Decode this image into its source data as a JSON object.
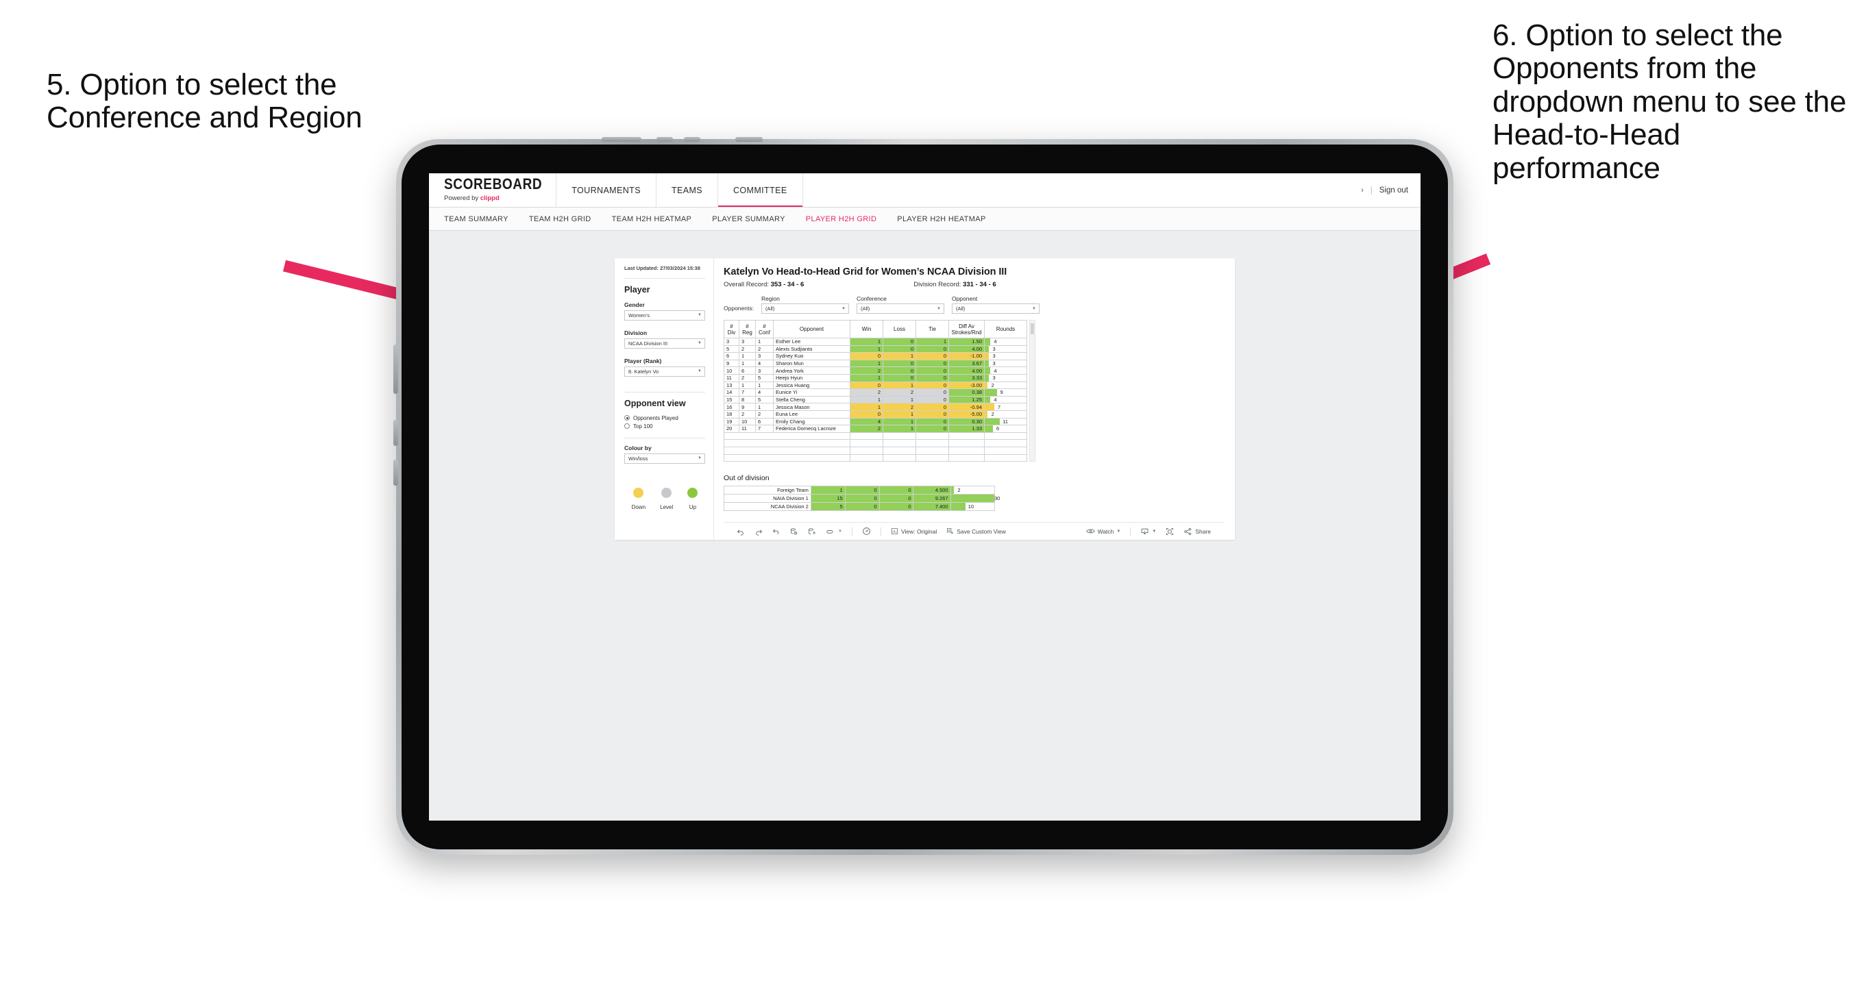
{
  "annotations": {
    "left": "5. Option to select the Conference and Region",
    "right": "6. Option to select the Opponents from the dropdown menu to see the Head-to-Head performance",
    "arrow_color": "#e8295f"
  },
  "app": {
    "brand": {
      "title": "SCOREBOARD",
      "powered_prefix": "Powered by ",
      "powered_brand": "clippd"
    },
    "topnav": [
      {
        "label": "TOURNAMENTS",
        "active": false
      },
      {
        "label": "TEAMS",
        "active": false
      },
      {
        "label": "COMMITTEE",
        "active": true
      }
    ],
    "topbar_right": {
      "chevron": "›",
      "separator": "|",
      "signout": "Sign out"
    },
    "subnav": [
      {
        "label": "TEAM SUMMARY",
        "active": false
      },
      {
        "label": "TEAM H2H GRID",
        "active": false
      },
      {
        "label": "TEAM H2H HEATMAP",
        "active": false
      },
      {
        "label": "PLAYER SUMMARY",
        "active": false
      },
      {
        "label": "PLAYER H2H GRID",
        "active": true
      },
      {
        "label": "PLAYER H2H HEATMAP",
        "active": false
      }
    ],
    "accent": "#e8295f"
  },
  "sidebar": {
    "last_updated": "Last Updated: 27/03/2024 15:38",
    "section_player": "Player",
    "fields": [
      {
        "label": "Gender",
        "value": "Women’s"
      },
      {
        "label": "Division",
        "value": "NCAA Division III"
      },
      {
        "label": "Player (Rank)",
        "value": "8. Katelyn Vo"
      }
    ],
    "opponent_view": {
      "title": "Opponent view",
      "options": [
        {
          "label": "Opponents Played",
          "selected": true
        },
        {
          "label": "Top 100",
          "selected": false
        }
      ]
    },
    "colour_by": {
      "label": "Colour by",
      "value": "Win/loss"
    },
    "legend": [
      {
        "label": "Down",
        "color": "#f5d04e"
      },
      {
        "label": "Level",
        "color": "#c6c8cb"
      },
      {
        "label": "Up",
        "color": "#8cc63e"
      }
    ]
  },
  "main": {
    "title": "Katelyn Vo Head-to-Head Grid for Women’s NCAA Division III",
    "overall_record_label": "Overall Record:",
    "overall_record_value": "353 -  34 - 6",
    "division_record_label": "Division Record:",
    "division_record_value": "331 -  34 - 6",
    "opponents_label": "Opponents:",
    "filters": [
      {
        "label": "Region",
        "value": "(All)"
      },
      {
        "label": "Conference",
        "value": "(All)"
      },
      {
        "label": "Opponent",
        "value": "(All)"
      }
    ],
    "out_of_division_title": "Out of division"
  },
  "chart_data": {
    "type": "table",
    "title": "Katelyn Vo Head-to-Head Grid for Women’s NCAA Division III",
    "columns": [
      "# Div",
      "# Reg",
      "# Conf",
      "Opponent",
      "Win",
      "Loss",
      "Tie",
      "Diff Av Strokes/Rnd",
      "Rounds"
    ],
    "column_headers_multiline": [
      [
        "#",
        "Div"
      ],
      [
        "#",
        "Reg"
      ],
      [
        "#",
        "Conf"
      ],
      [
        "Opponent"
      ],
      [
        "Win"
      ],
      [
        "Loss"
      ],
      [
        "Tie"
      ],
      [
        "Diff Av",
        "Strokes/Rnd"
      ],
      [
        "Rounds"
      ]
    ],
    "colour_scale": {
      "up": "#92d05a",
      "level": "#d5d7d9",
      "down": "#f5d04e"
    },
    "rounds_max": 30,
    "rows": [
      {
        "div": "3",
        "reg": "3",
        "conf": "1",
        "opponent": "Esther Lee",
        "win": "1",
        "loss": "0",
        "tie": "1",
        "diff": "1.50",
        "rounds": "4",
        "colour": "up"
      },
      {
        "div": "5",
        "reg": "2",
        "conf": "2",
        "opponent": "Alexis Sudjianto",
        "win": "1",
        "loss": "0",
        "tie": "0",
        "diff": "4.00",
        "rounds": "3",
        "colour": "up"
      },
      {
        "div": "6",
        "reg": "1",
        "conf": "3",
        "opponent": "Sydney Kuo",
        "win": "0",
        "loss": "1",
        "tie": "0",
        "diff": "-1.00",
        "rounds": "3",
        "colour": "down"
      },
      {
        "div": "9",
        "reg": "1",
        "conf": "4",
        "opponent": "Sharon Mun",
        "win": "1",
        "loss": "0",
        "tie": "0",
        "diff": "3.67",
        "rounds": "3",
        "colour": "up"
      },
      {
        "div": "10",
        "reg": "6",
        "conf": "3",
        "opponent": "Andrea York",
        "win": "2",
        "loss": "0",
        "tie": "0",
        "diff": "4.00",
        "rounds": "4",
        "colour": "up"
      },
      {
        "div": "11",
        "reg": "2",
        "conf": "5",
        "opponent": "Heejo Hyun",
        "win": "1",
        "loss": "0",
        "tie": "0",
        "diff": "3.33",
        "rounds": "3",
        "colour": "up"
      },
      {
        "div": "13",
        "reg": "1",
        "conf": "1",
        "opponent": "Jessica Huang",
        "win": "0",
        "loss": "1",
        "tie": "0",
        "diff": "-3.00",
        "rounds": "2",
        "colour": "down"
      },
      {
        "div": "14",
        "reg": "7",
        "conf": "4",
        "opponent": "Eunice Yi",
        "win": "2",
        "loss": "2",
        "tie": "0",
        "diff": "0.38",
        "rounds": "9",
        "colour": "level",
        "diff_colour": "up"
      },
      {
        "div": "15",
        "reg": "8",
        "conf": "5",
        "opponent": "Stella Cheng",
        "win": "1",
        "loss": "1",
        "tie": "0",
        "diff": "1.25",
        "rounds": "4",
        "colour": "level",
        "diff_colour": "up"
      },
      {
        "div": "16",
        "reg": "9",
        "conf": "1",
        "opponent": "Jessica Mason",
        "win": "1",
        "loss": "2",
        "tie": "0",
        "diff": "-0.94",
        "rounds": "7",
        "colour": "down"
      },
      {
        "div": "18",
        "reg": "2",
        "conf": "2",
        "opponent": "Euna Lee",
        "win": "0",
        "loss": "1",
        "tie": "0",
        "diff": "-5.00",
        "rounds": "2",
        "colour": "down"
      },
      {
        "div": "19",
        "reg": "10",
        "conf": "6",
        "opponent": "Emily Chang",
        "win": "4",
        "loss": "1",
        "tie": "0",
        "diff": "0.30",
        "rounds": "11",
        "colour": "up"
      },
      {
        "div": "20",
        "reg": "11",
        "conf": "7",
        "opponent": "Federica Domecq Lacroze",
        "win": "2",
        "loss": "1",
        "tie": "0",
        "diff": "1.33",
        "rounds": "6",
        "colour": "up"
      }
    ],
    "out_of_division": {
      "title": "Out of division",
      "rounds_max": 30,
      "rows": [
        {
          "name": "Foreign Team",
          "win": "1",
          "loss": "0",
          "tie": "0",
          "diff": "4.500",
          "rounds": "2",
          "colour": "up"
        },
        {
          "name": "NAIA Division 1",
          "win": "15",
          "loss": "0",
          "tie": "0",
          "diff": "9.267",
          "rounds": "30",
          "colour": "up"
        },
        {
          "name": "NCAA Division 2",
          "win": "5",
          "loss": "0",
          "tie": "0",
          "diff": "7.400",
          "rounds": "10",
          "colour": "up"
        }
      ]
    }
  },
  "toolbar": {
    "view_label": "View: Original",
    "save_label": "Save Custom View",
    "watch_label": "Watch",
    "share_label": "Share"
  }
}
